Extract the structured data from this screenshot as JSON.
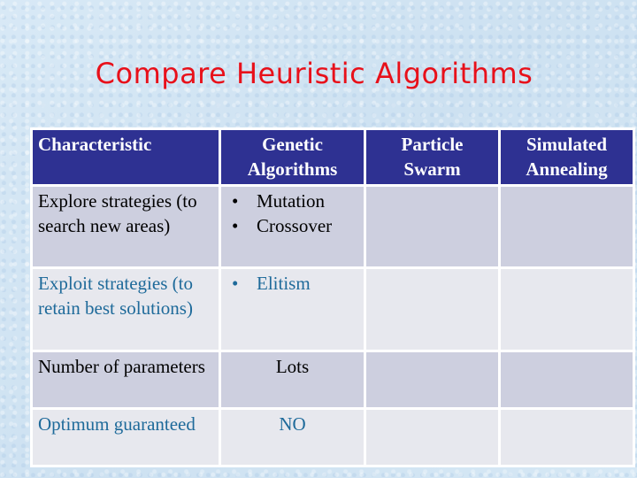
{
  "title": "Compare Heuristic Algorithms",
  "colors": {
    "title": "#e8101a",
    "header_bg": "#2e3192",
    "header_text": "#ffffff",
    "row_dark_bg": "#cdcfdf",
    "row_light_bg": "#e7e8ee",
    "row_light_text": "#1e6a9a",
    "background": "#d3e5f3"
  },
  "table": {
    "headers": [
      "Characteristic",
      "Genetic Algorithms",
      "Particle Swarm",
      "Simulated Annealing"
    ],
    "rows": [
      {
        "characteristic": "Explore strategies (to search new areas)",
        "genetic": [
          "Mutation",
          "Crossover"
        ],
        "particle": "",
        "annealing": ""
      },
      {
        "characteristic": "Exploit strategies (to retain best solutions)",
        "genetic": [
          "Elitism"
        ],
        "particle": "",
        "annealing": ""
      },
      {
        "characteristic": "Number of parameters",
        "genetic": "Lots",
        "particle": "",
        "annealing": ""
      },
      {
        "characteristic": "Optimum guaranteed",
        "genetic": "NO",
        "particle": "",
        "annealing": ""
      }
    ]
  }
}
